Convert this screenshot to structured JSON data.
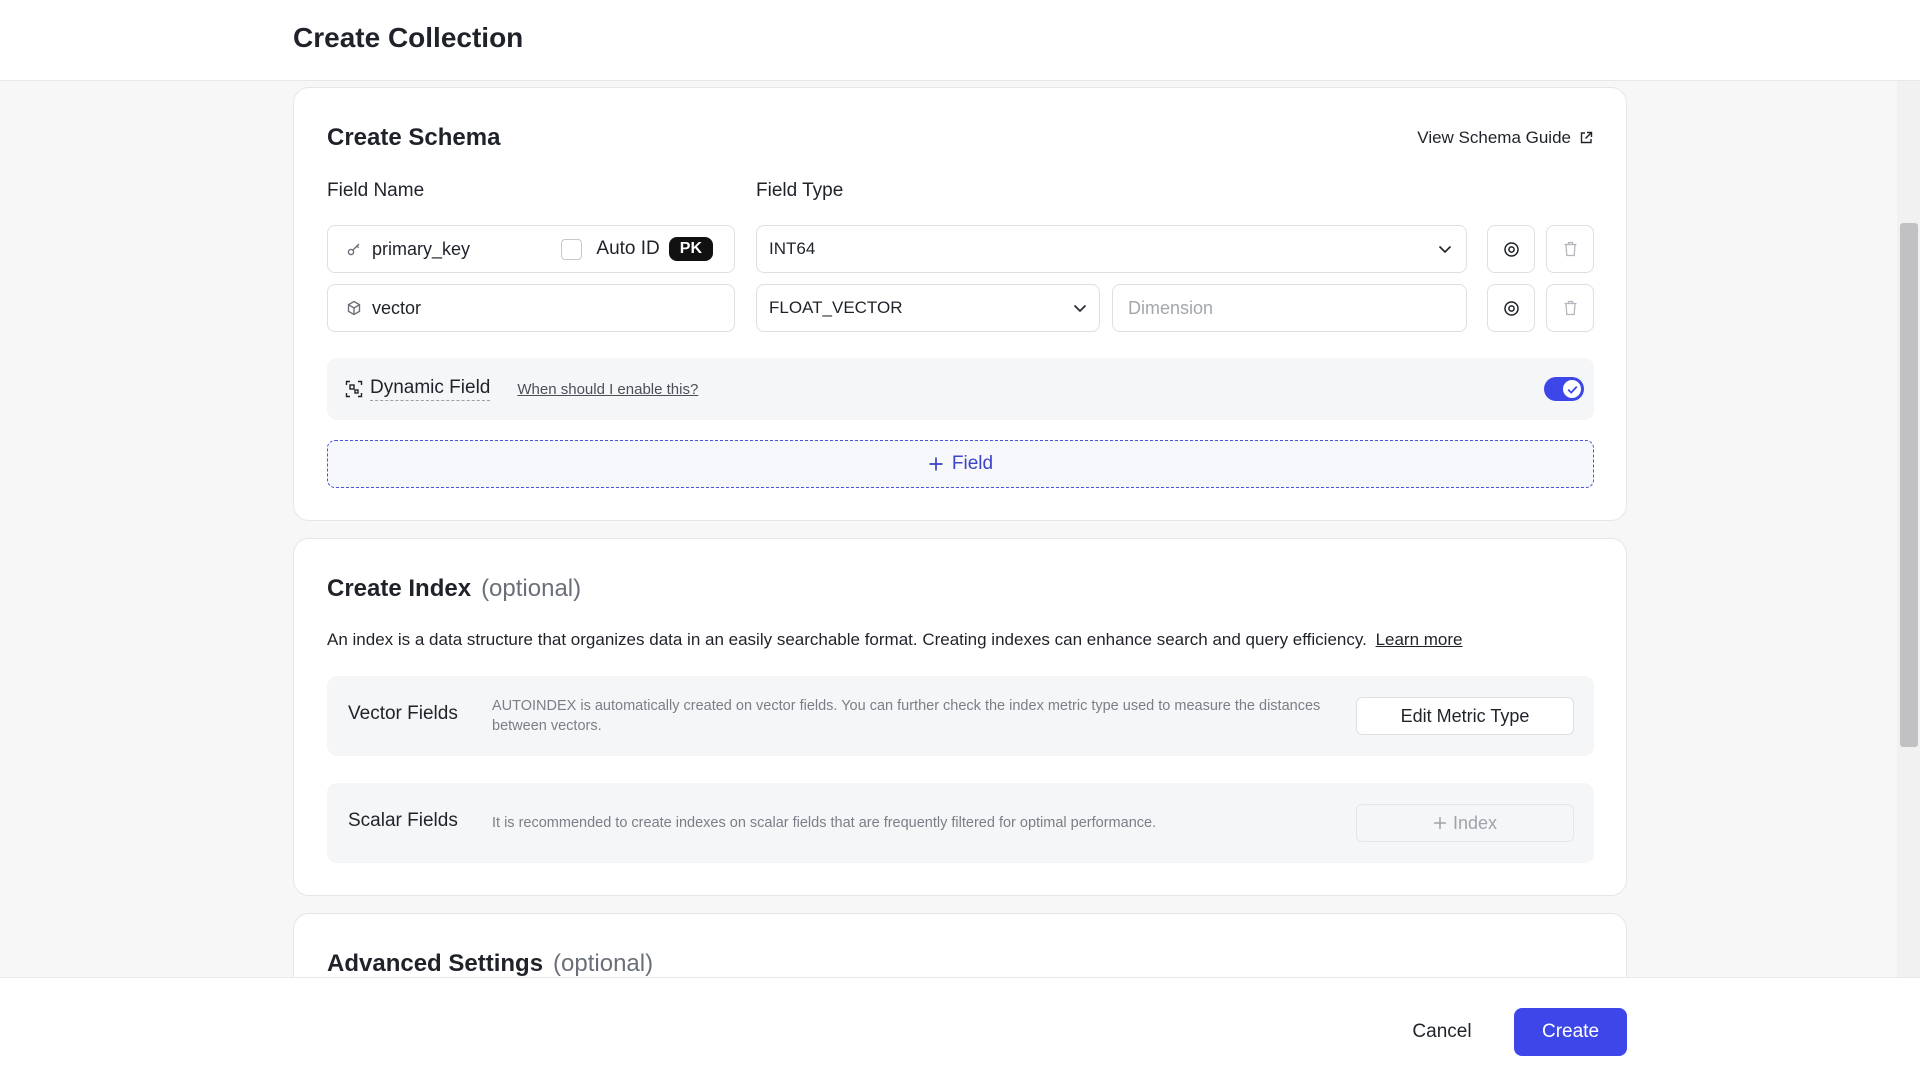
{
  "header": {
    "title": "Create Collection"
  },
  "schema": {
    "title": "Create Schema",
    "guide_link": "View Schema Guide",
    "field_name_label": "Field Name",
    "field_type_label": "Field Type",
    "fields": [
      {
        "name": "primary_key",
        "icon": "key-icon",
        "auto_id_label": "Auto ID",
        "auto_id_checked": false,
        "badge": "PK",
        "type": "INT64"
      },
      {
        "name": "vector",
        "icon": "vector-icon",
        "type": "FLOAT_VECTOR",
        "dimension_placeholder": "Dimension"
      }
    ],
    "dynamic_field": {
      "label": "Dynamic Field",
      "help_link": "When should I enable this?",
      "enabled": true
    },
    "add_field_label": "Field"
  },
  "index": {
    "title": "Create Index",
    "optional": "(optional)",
    "description": "An index is a data structure that organizes data in an easily searchable format. Creating indexes can enhance search and query efficiency.",
    "learn_more": "Learn more",
    "vector_fields": {
      "title": "Vector Fields",
      "description": "AUTOINDEX is automatically created on vector fields. You can further check the index metric type used to measure the distances between vectors.",
      "button": "Edit Metric Type"
    },
    "scalar_fields": {
      "title": "Scalar Fields",
      "description": "It is recommended to create indexes on scalar fields that are frequently filtered for optimal performance.",
      "button": "Index"
    }
  },
  "advanced": {
    "title": "Advanced Settings",
    "optional": "(optional)"
  },
  "footer": {
    "cancel": "Cancel",
    "create": "Create"
  },
  "colors": {
    "primary": "#3d46e8",
    "border": "#dcdfe4",
    "panel": "#f5f6f8"
  }
}
